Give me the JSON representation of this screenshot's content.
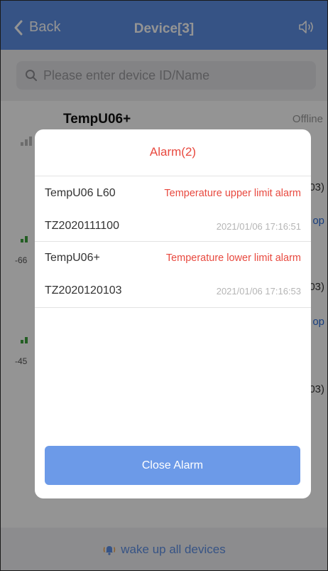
{
  "navbar": {
    "back_label": "Back",
    "title": "Device[3]"
  },
  "search": {
    "placeholder": "Please enter device ID/Name"
  },
  "devices": [
    {
      "name": "TempU06+",
      "status": "Offline",
      "edge_value": "03)",
      "edge_link": "op",
      "rssi": ""
    },
    {
      "name": "",
      "status": "",
      "edge_value": "03)",
      "edge_link": "op",
      "rssi": "-66"
    },
    {
      "name": "",
      "status": "",
      "edge_value": "03)",
      "edge_link": "",
      "rssi": "-45"
    }
  ],
  "bottom_bar": {
    "label": "wake up all devices"
  },
  "alarm_modal": {
    "title": "Alarm(2)",
    "alarms": [
      {
        "device_name": "TempU06 L60",
        "alarm_type": "Temperature upper limit alarm",
        "device_id": "TZ2020111100",
        "time": "2021/01/06 17:16:51"
      },
      {
        "device_name": "TempU06+",
        "alarm_type": "Temperature lower limit alarm",
        "device_id": "TZ2020120103",
        "time": "2021/01/06 17:16:53"
      }
    ],
    "close_label": "Close Alarm"
  },
  "colors": {
    "primary": "#5e8fe6",
    "alarm_red": "#e8493f",
    "signal_green": "#3fa33f"
  }
}
